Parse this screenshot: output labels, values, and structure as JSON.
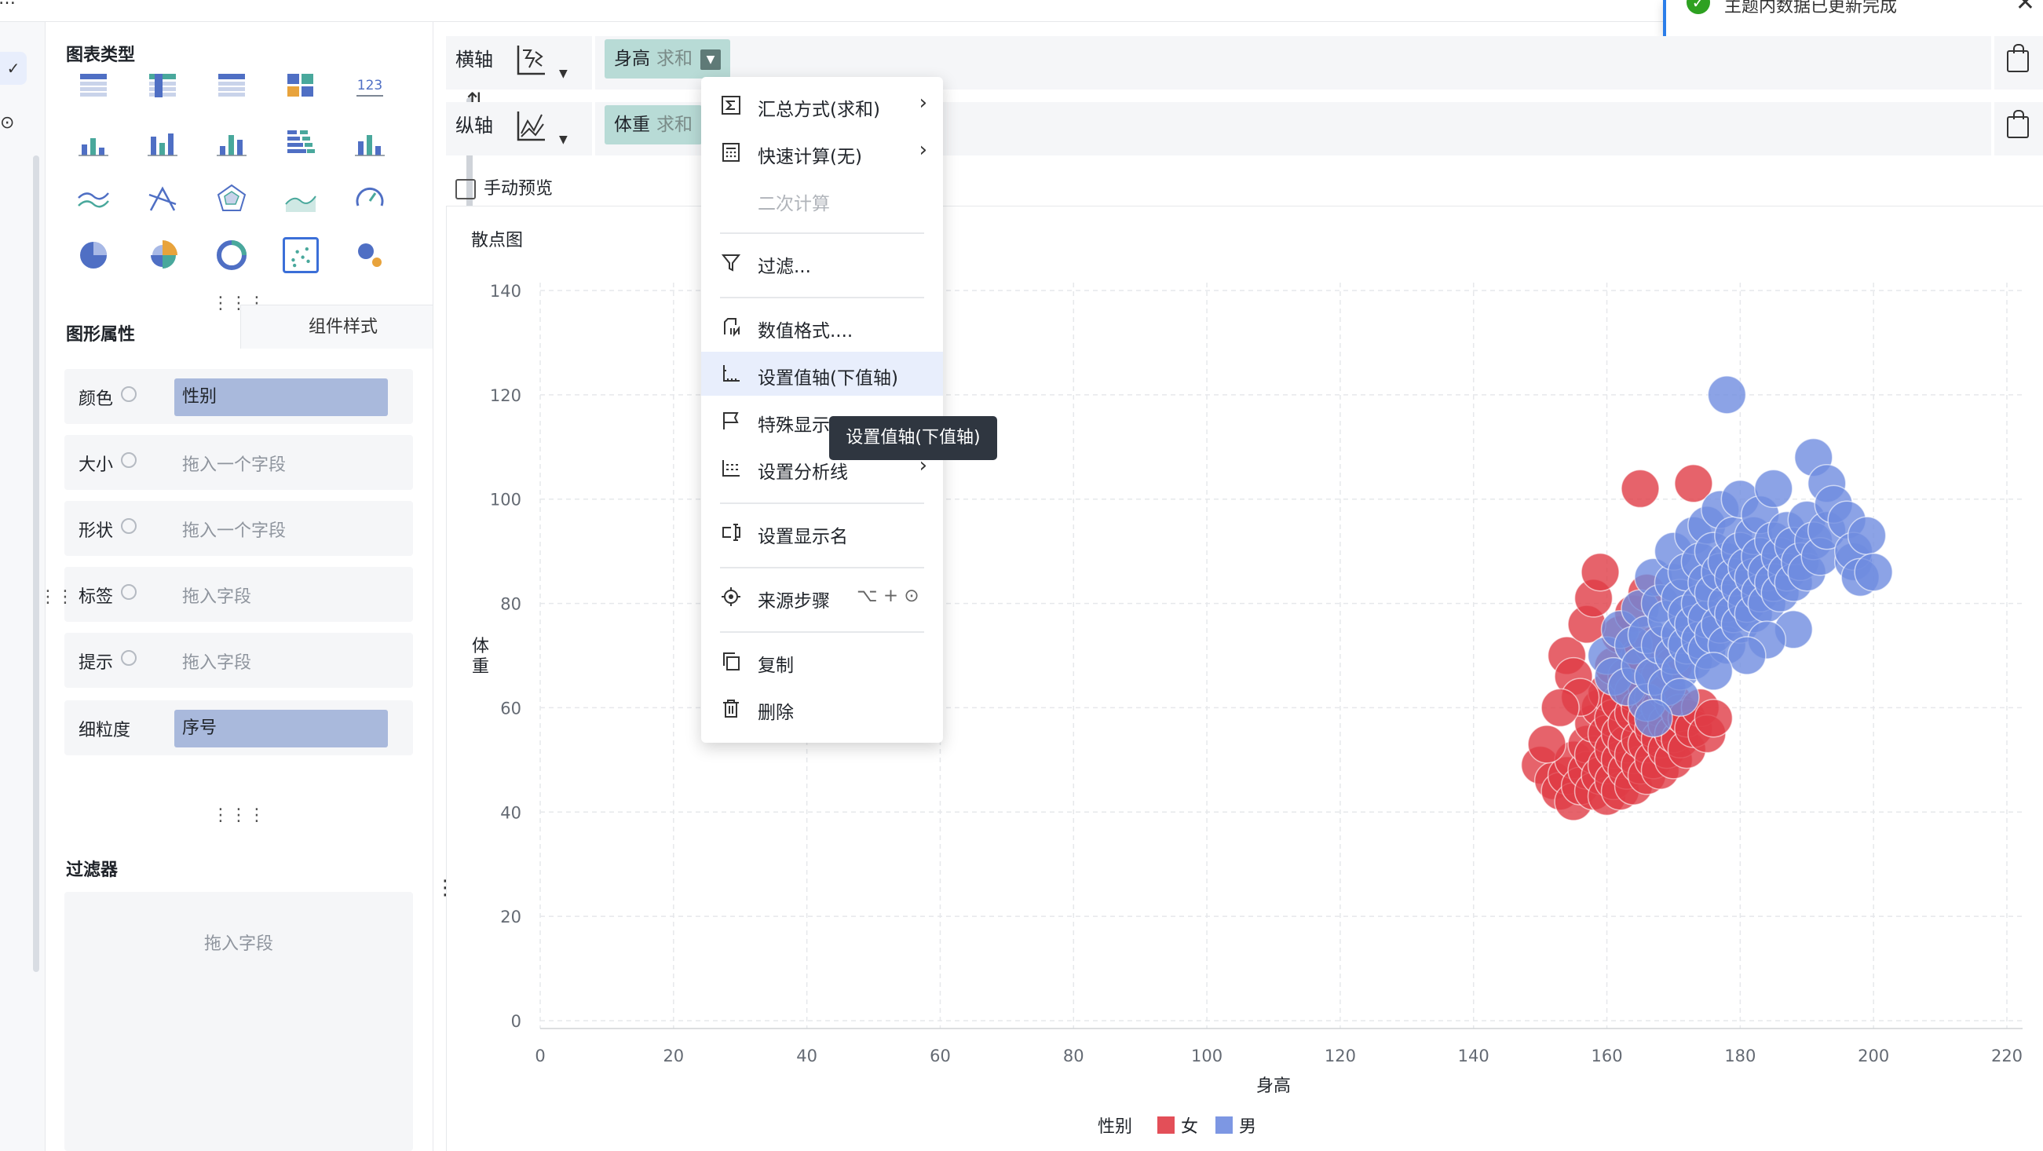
{
  "toast": {
    "message": "主题内数据已更新完成"
  },
  "panel": {
    "chart_types_title": "图表类型",
    "chart_type_icons": [
      "table-icon",
      "pivot-table-icon",
      "detail-table-icon",
      "card-icon",
      "kpi-number-icon",
      "stacked-bar-icon",
      "grouped-bar-icon",
      "column-icon",
      "horizontal-bar-icon",
      "waterfall-icon",
      "line-icon",
      "radar-icon",
      "polar-icon",
      "area-icon",
      "gauge-icon",
      "pie-icon",
      "rose-icon",
      "ring-icon",
      "scatter-icon",
      "bubble-icon"
    ],
    "kpi_text": "123",
    "properties_tab": "图形属性",
    "style_tab": "组件样式",
    "rows": [
      {
        "label": "颜色",
        "value": "性别",
        "filled": true
      },
      {
        "label": "大小",
        "value": "拖入一个字段",
        "filled": false
      },
      {
        "label": "形状",
        "value": "拖入一个字段",
        "filled": false
      },
      {
        "label": "标签",
        "value": "拖入字段",
        "filled": false
      },
      {
        "label": "提示",
        "value": "拖入字段",
        "filled": false
      },
      {
        "label": "细粒度",
        "value": "序号",
        "filled": true
      }
    ],
    "filter_title": "过滤器",
    "filter_placeholder": "拖入字段"
  },
  "shelves": {
    "x_label": "横轴",
    "y_label": "纵轴",
    "x_field": "身高",
    "x_agg": "求和",
    "y_field": "体重",
    "y_agg": "求和"
  },
  "manual_preview": "手动预览",
  "chart_title": "散点图",
  "menu": {
    "items": [
      {
        "label": "汇总方式(求和)",
        "submenu": true,
        "icon": "sigma-icon"
      },
      {
        "label": "快速计算(无)",
        "submenu": true,
        "icon": "calculator-icon"
      },
      {
        "label": "二次计算",
        "disabled": true
      },
      {
        "label": "过滤...",
        "icon": "filter-icon"
      },
      {
        "label": "数值格式....",
        "icon": "number-format-icon"
      },
      {
        "label": "设置值轴(下值轴)",
        "icon": "axis-icon",
        "highlighted": true
      },
      {
        "label": "特殊显示",
        "icon": "flag-icon"
      },
      {
        "label": "设置分析线",
        "submenu": true,
        "icon": "analysis-line-icon"
      },
      {
        "label": "设置显示名",
        "icon": "rename-icon"
      },
      {
        "label": "来源步骤",
        "shortcut": "⌥ + ",
        "icon": "source-step-icon"
      },
      {
        "label": "复制",
        "icon": "copy-icon"
      },
      {
        "label": "删除",
        "icon": "trash-icon"
      }
    ],
    "tooltip": "设置值轴(下值轴)"
  },
  "chart_data": {
    "type": "scatter",
    "title": "散点图",
    "xlabel": "身高",
    "ylabel": "体重",
    "xlim": [
      0,
      220
    ],
    "ylim": [
      0,
      140
    ],
    "x_ticks": [
      0,
      20,
      40,
      60,
      80,
      100,
      120,
      140,
      160,
      180,
      200,
      220
    ],
    "y_ticks": [
      0,
      20,
      40,
      60,
      80,
      100,
      120,
      140
    ],
    "grid": true,
    "legend_title": "性别",
    "legend_position": "bottom",
    "series": [
      {
        "name": "女",
        "color": "#e03c46",
        "points": [
          [
            150,
            49
          ],
          [
            152,
            46
          ],
          [
            153,
            44
          ],
          [
            154,
            47
          ],
          [
            155,
            42
          ],
          [
            155,
            50
          ],
          [
            156,
            45
          ],
          [
            157,
            48
          ],
          [
            157,
            53
          ],
          [
            158,
            44
          ],
          [
            158,
            51
          ],
          [
            158,
            57
          ],
          [
            159,
            47
          ],
          [
            159,
            60
          ],
          [
            160,
            43
          ],
          [
            160,
            49
          ],
          [
            160,
            55
          ],
          [
            160,
            63
          ],
          [
            161,
            46
          ],
          [
            161,
            52
          ],
          [
            161,
            58
          ],
          [
            161,
            68
          ],
          [
            162,
            44
          ],
          [
            162,
            50
          ],
          [
            162,
            55
          ],
          [
            162,
            61
          ],
          [
            162,
            74
          ],
          [
            163,
            48
          ],
          [
            163,
            53
          ],
          [
            163,
            57
          ],
          [
            163,
            66
          ],
          [
            164,
            45
          ],
          [
            164,
            51
          ],
          [
            164,
            59
          ],
          [
            164,
            63
          ],
          [
            164,
            78
          ],
          [
            165,
            49
          ],
          [
            165,
            54
          ],
          [
            165,
            60
          ],
          [
            165,
            70
          ],
          [
            165,
            102
          ],
          [
            166,
            47
          ],
          [
            166,
            53
          ],
          [
            166,
            58
          ],
          [
            166,
            64
          ],
          [
            166,
            82
          ],
          [
            167,
            50
          ],
          [
            167,
            56
          ],
          [
            167,
            62
          ],
          [
            167,
            72
          ],
          [
            168,
            48
          ],
          [
            168,
            54
          ],
          [
            168,
            60
          ],
          [
            168,
            66
          ],
          [
            169,
            52
          ],
          [
            169,
            57
          ],
          [
            169,
            63
          ],
          [
            170,
            50
          ],
          [
            170,
            55
          ],
          [
            170,
            61
          ],
          [
            170,
            68
          ],
          [
            171,
            54
          ],
          [
            171,
            59
          ],
          [
            172,
            52
          ],
          [
            172,
            58
          ],
          [
            173,
            103
          ],
          [
            173,
            56
          ],
          [
            174,
            60
          ],
          [
            175,
            55
          ],
          [
            176,
            58
          ],
          [
            154,
            70
          ],
          [
            155,
            66
          ],
          [
            156,
            62
          ],
          [
            157,
            76
          ],
          [
            158,
            81
          ],
          [
            153,
            60
          ],
          [
            151,
            53
          ],
          [
            159,
            86
          ]
        ]
      },
      {
        "name": "男",
        "color": "#6f8ce0",
        "points": [
          [
            160,
            70
          ],
          [
            161,
            66
          ],
          [
            162,
            75
          ],
          [
            163,
            64
          ],
          [
            164,
            72
          ],
          [
            165,
            68
          ],
          [
            165,
            79
          ],
          [
            166,
            61
          ],
          [
            166,
            74
          ],
          [
            167,
            85
          ],
          [
            167,
            66
          ],
          [
            168,
            72
          ],
          [
            168,
            80
          ],
          [
            169,
            64
          ],
          [
            169,
            77
          ],
          [
            170,
            70
          ],
          [
            170,
            84
          ],
          [
            170,
            90
          ],
          [
            171,
            67
          ],
          [
            171,
            74
          ],
          [
            171,
            81
          ],
          [
            172,
            72
          ],
          [
            172,
            78
          ],
          [
            172,
            86
          ],
          [
            173,
            69
          ],
          [
            173,
            76
          ],
          [
            173,
            93
          ],
          [
            174,
            73
          ],
          [
            174,
            80
          ],
          [
            174,
            88
          ],
          [
            175,
            71
          ],
          [
            175,
            77
          ],
          [
            175,
            84
          ],
          [
            175,
            95
          ],
          [
            176,
            74
          ],
          [
            176,
            82
          ],
          [
            176,
            90
          ],
          [
            177,
            76
          ],
          [
            177,
            86
          ],
          [
            177,
            98
          ],
          [
            178,
            72
          ],
          [
            178,
            80
          ],
          [
            178,
            88
          ],
          [
            178,
            120
          ],
          [
            179,
            78
          ],
          [
            179,
            85
          ],
          [
            179,
            93
          ],
          [
            180,
            76
          ],
          [
            180,
            83
          ],
          [
            180,
            90
          ],
          [
            180,
            100
          ],
          [
            181,
            80
          ],
          [
            181,
            87
          ],
          [
            182,
            78
          ],
          [
            182,
            85
          ],
          [
            182,
            93
          ],
          [
            183,
            82
          ],
          [
            183,
            89
          ],
          [
            183,
            97
          ],
          [
            184,
            80
          ],
          [
            184,
            86
          ],
          [
            185,
            84
          ],
          [
            185,
            92
          ],
          [
            185,
            102
          ],
          [
            186,
            82
          ],
          [
            186,
            89
          ],
          [
            187,
            86
          ],
          [
            187,
            94
          ],
          [
            188,
            84
          ],
          [
            188,
            91
          ],
          [
            189,
            88
          ],
          [
            190,
            86
          ],
          [
            190,
            96
          ],
          [
            191,
            92
          ],
          [
            191,
            108
          ],
          [
            192,
            89
          ],
          [
            193,
            94
          ],
          [
            193,
            103
          ],
          [
            194,
            99
          ],
          [
            196,
            96
          ],
          [
            197,
            88
          ],
          [
            197,
            90
          ],
          [
            198,
            85
          ],
          [
            199,
            93
          ],
          [
            200,
            86
          ],
          [
            188,
            75
          ],
          [
            184,
            73
          ],
          [
            181,
            70
          ],
          [
            176,
            67
          ],
          [
            171,
            62
          ],
          [
            167,
            58
          ]
        ]
      }
    ]
  }
}
